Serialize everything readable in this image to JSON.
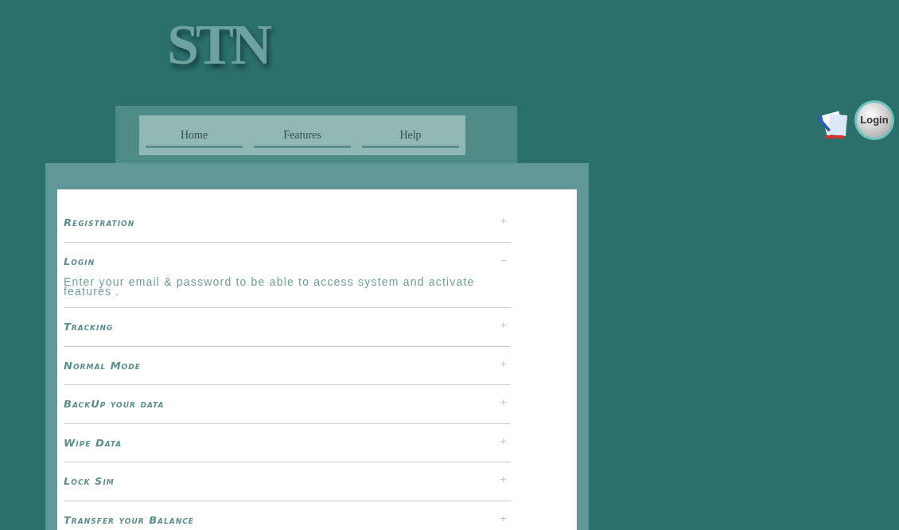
{
  "logo": "STN",
  "nav": [
    {
      "label": "Home"
    },
    {
      "label": "Features"
    },
    {
      "label": "Help"
    }
  ],
  "login_button": "Login",
  "accordion": [
    {
      "title": "Registration",
      "expanded": false
    },
    {
      "title": "Login",
      "expanded": true,
      "body": "Enter your email & password to be able to access system and activate features ."
    },
    {
      "title": "Tracking",
      "expanded": false
    },
    {
      "title": "Normal Mode",
      "expanded": false
    },
    {
      "title": "BackUp your data",
      "expanded": false
    },
    {
      "title": "Wipe Data",
      "expanded": false
    },
    {
      "title": "Lock Sim",
      "expanded": false
    },
    {
      "title": "Transfer your Balance",
      "expanded": false
    }
  ]
}
